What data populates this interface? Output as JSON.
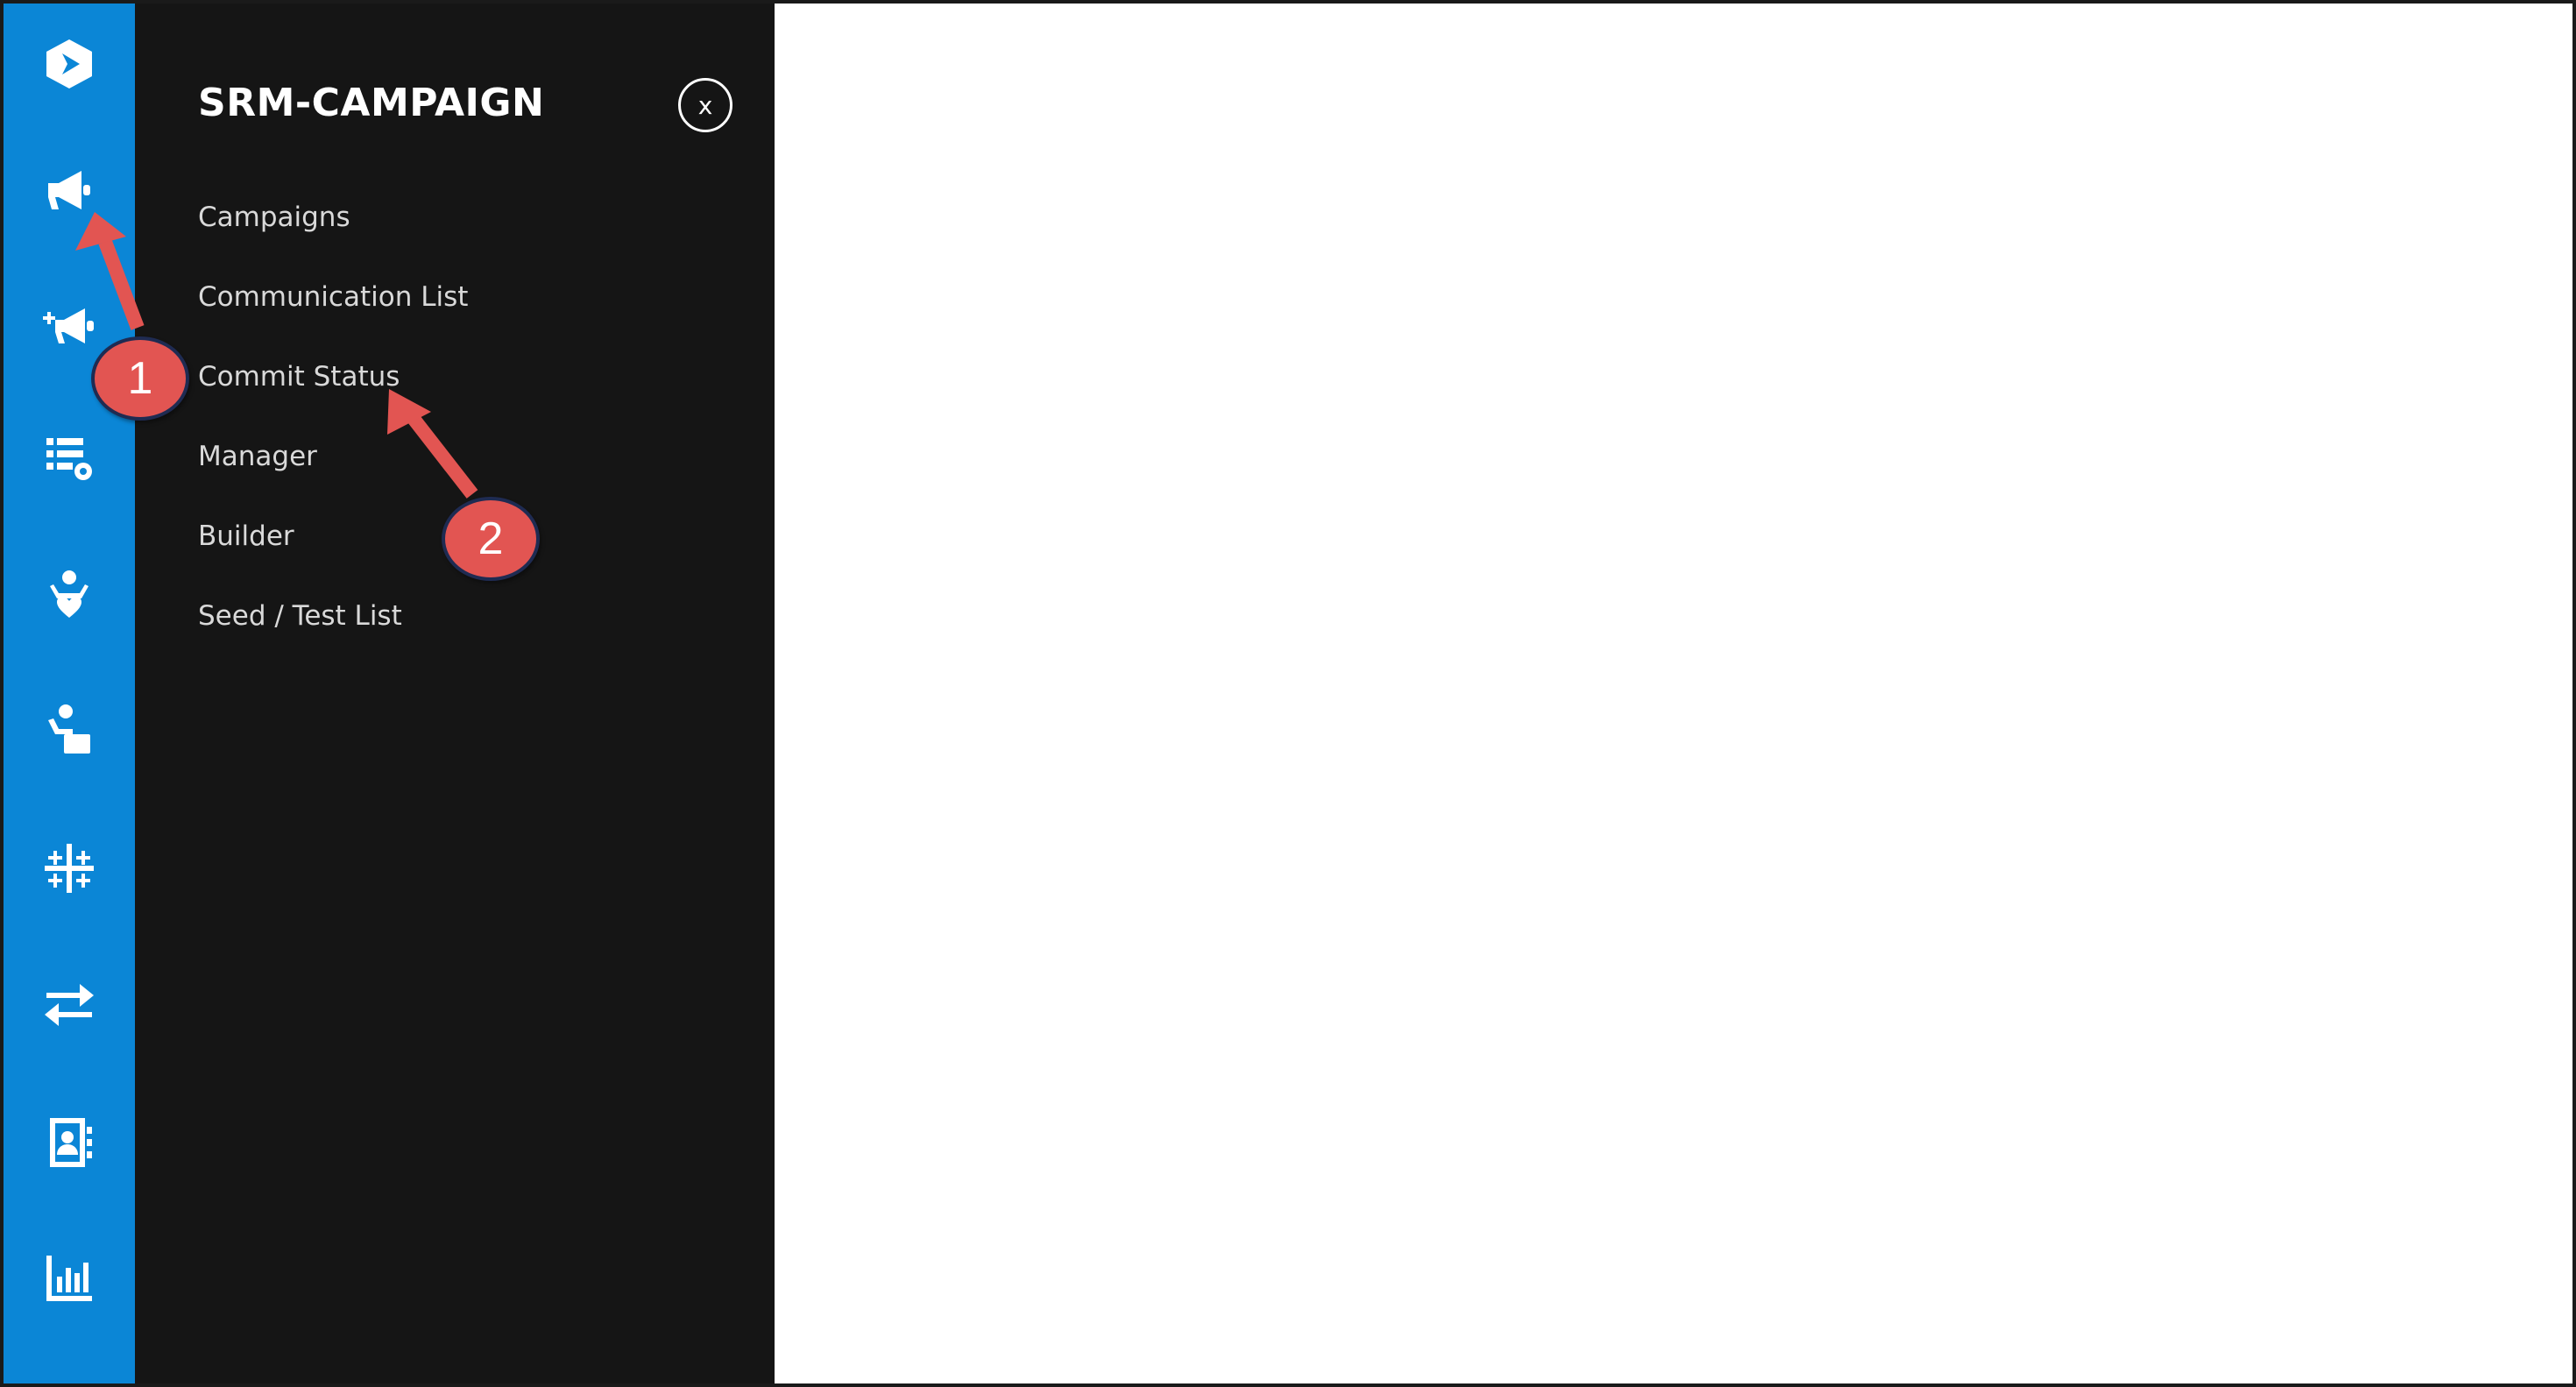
{
  "menu": {
    "title": "SRM-CAMPAIGN",
    "close_label": "x",
    "items": [
      {
        "label": "Campaigns"
      },
      {
        "label": "Communication List"
      },
      {
        "label": "Commit Status"
      },
      {
        "label": "Manager"
      },
      {
        "label": "Builder"
      },
      {
        "label": "Seed / Test List"
      }
    ]
  },
  "rail": {
    "icons": [
      "logo-icon",
      "megaphone-icon",
      "megaphone-add-icon",
      "list-settings-icon",
      "person-heart-icon",
      "person-card-icon",
      "grid-sparkle-icon",
      "swap-arrows-icon",
      "contact-book-icon",
      "bar-chart-icon"
    ]
  },
  "annotations": {
    "callout_1": "1",
    "callout_2": "2",
    "color": "#e25552"
  },
  "colors": {
    "rail": "#0b86d6",
    "menu": "#151515",
    "content": "#ffffff"
  }
}
